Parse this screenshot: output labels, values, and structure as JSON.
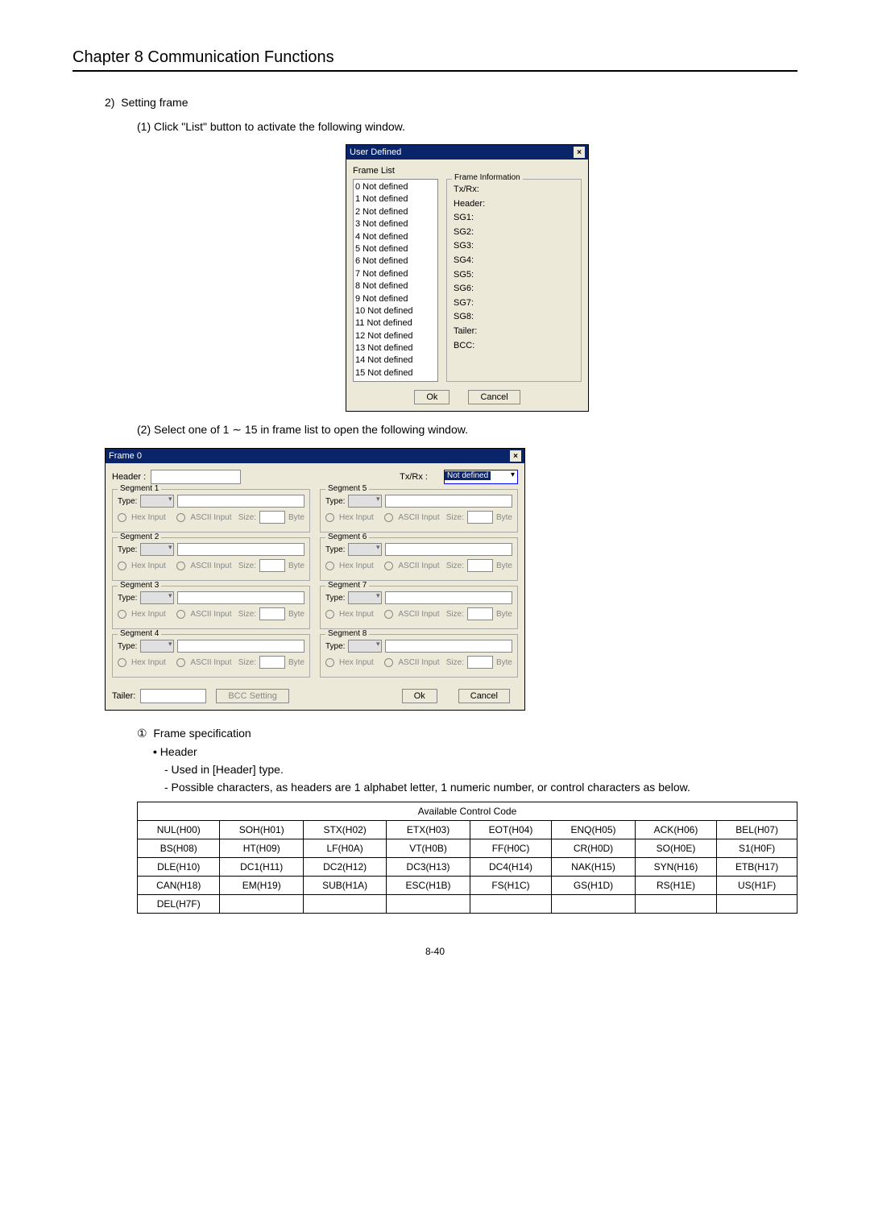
{
  "chapter": "Chapter 8   Communication Functions",
  "section": {
    "num": "2)",
    "title": "Setting frame",
    "step1": "(1) Click \"List\" button to activate the following window.",
    "step2": "(2) Select one of 1 ∼ 15 in frame list to open the following window."
  },
  "dlg1": {
    "title": "User Defined",
    "framelist_label": "Frame List",
    "items": [
      "0 Not defined",
      "1 Not defined",
      "2 Not defined",
      "3 Not defined",
      "4 Not defined",
      "5 Not defined",
      "6 Not defined",
      "7 Not defined",
      "8 Not defined",
      "9 Not defined",
      "10 Not defined",
      "11 Not defined",
      "12 Not defined",
      "13 Not defined",
      "14 Not defined",
      "15 Not defined"
    ],
    "info_title": "Frame Information",
    "info": [
      "Tx/Rx:",
      "Header:",
      "SG1:",
      "SG2:",
      "SG3:",
      "SG4:",
      "SG5:",
      "SG6:",
      "SG7:",
      "SG8:",
      "Tailer:",
      "BCC:"
    ],
    "ok": "Ok",
    "cancel": "Cancel"
  },
  "dlg2": {
    "title": "Frame 0",
    "header_lbl": "Header :",
    "txrx_lbl": "Tx/Rx :",
    "txrx_val": "Not defined",
    "segments": [
      "Segment 1",
      "Segment 2",
      "Segment 3",
      "Segment 4",
      "Segment 5",
      "Segment 6",
      "Segment 7",
      "Segment 8"
    ],
    "type_lbl": "Type:",
    "hex": "Hex Input",
    "ascii": "ASCII Input",
    "size": "Size:",
    "byte": "Byte",
    "tailer_lbl": "Tailer:",
    "bcc_btn": "BCC Setting",
    "ok": "Ok",
    "cancel": "Cancel"
  },
  "spec": {
    "num": "①",
    "title": "Frame specification",
    "header_h": "Header",
    "line1": "- Used in [Header] type.",
    "line2": "- Possible characters, as headers are 1 alphabet letter, 1 numeric number, or control characters as below."
  },
  "table": {
    "caption": "Available Control Code",
    "rows": [
      [
        "NUL(H00)",
        "SOH(H01)",
        "STX(H02)",
        "ETX(H03)",
        "EOT(H04)",
        "ENQ(H05)",
        "ACK(H06)",
        "BEL(H07)"
      ],
      [
        "BS(H08)",
        "HT(H09)",
        "LF(H0A)",
        "VT(H0B)",
        "FF(H0C)",
        "CR(H0D)",
        "SO(H0E)",
        "S1(H0F)"
      ],
      [
        "DLE(H10)",
        "DC1(H11)",
        "DC2(H12)",
        "DC3(H13)",
        "DC4(H14)",
        "NAK(H15)",
        "SYN(H16)",
        "ETB(H17)"
      ],
      [
        "CAN(H18)",
        "EM(H19)",
        "SUB(H1A)",
        "ESC(H1B)",
        "FS(H1C)",
        "GS(H1D)",
        "RS(H1E)",
        "US(H1F)"
      ],
      [
        "DEL(H7F)",
        "",
        "",
        "",
        "",
        "",
        "",
        ""
      ]
    ]
  },
  "pagenum": "8-40"
}
